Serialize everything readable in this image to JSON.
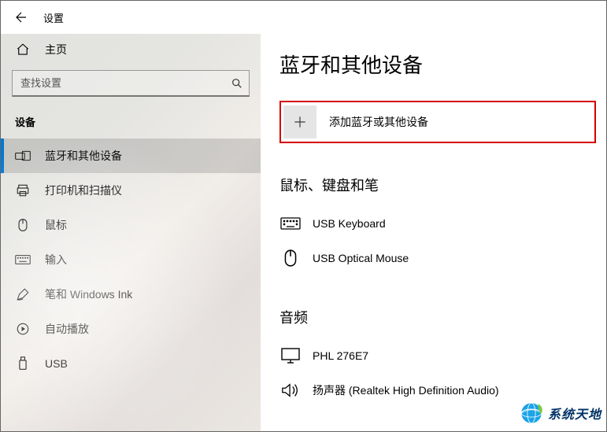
{
  "topbar": {
    "title": "设置"
  },
  "sidebar": {
    "home_label": "主页",
    "search_placeholder": "查找设置",
    "section_title": "设备",
    "items": [
      {
        "label": "蓝牙和其他设备"
      },
      {
        "label": "打印机和扫描仪"
      },
      {
        "label": "鼠标"
      },
      {
        "label": "输入"
      },
      {
        "label": "笔和 Windows Ink"
      },
      {
        "label": "自动播放"
      },
      {
        "label": "USB"
      }
    ]
  },
  "main": {
    "heading": "蓝牙和其他设备",
    "add_device_label": "添加蓝牙或其他设备",
    "section_mouse_keyboard_pen": "鼠标、键盘和笔",
    "devices_mkp": [
      {
        "label": "USB Keyboard"
      },
      {
        "label": "USB Optical Mouse"
      }
    ],
    "section_audio": "音频",
    "devices_audio": [
      {
        "label": "PHL 276E7"
      },
      {
        "label": "扬声器 (Realtek High Definition Audio)"
      }
    ]
  },
  "watermark": {
    "text": "系统天地"
  }
}
